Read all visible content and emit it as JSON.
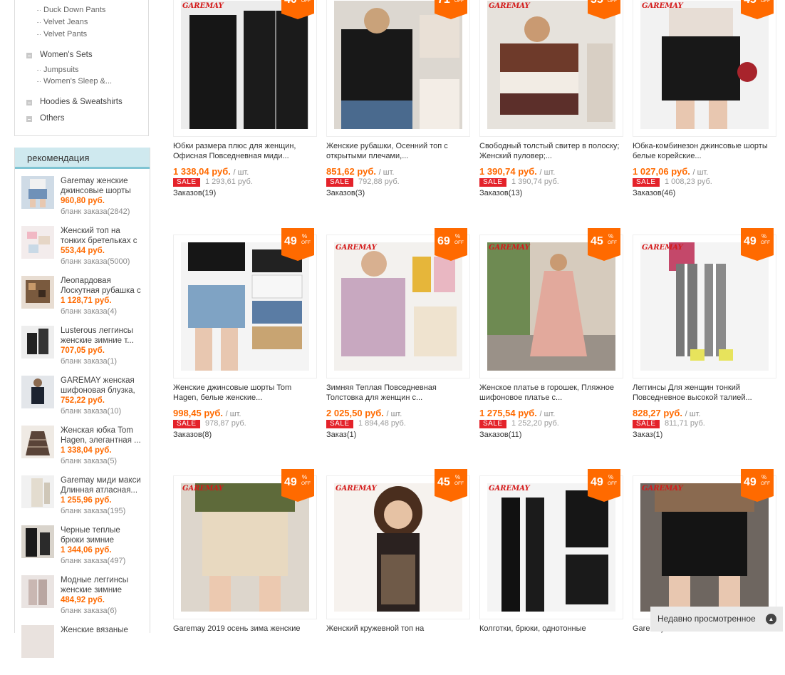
{
  "sidebar": {
    "categories_top": [
      "Duck Down Pants",
      "Velvet Jeans",
      "Velvet Pants"
    ],
    "womens_sets": "Women's Sets",
    "womens_sets_subs": [
      "Jumpsuits",
      "Women's Sleep &..."
    ],
    "hoodies": "Hoodies & Sweatshirts",
    "others": "Others"
  },
  "recommendation": {
    "heading": "рекомендация",
    "items": [
      {
        "title": "Garemay женские джинсовые шорты",
        "price": "960,80 руб.",
        "orders": "бланк заказа(2842)"
      },
      {
        "title": "Женский топ на тонких бретельках с",
        "price": "553,44 руб.",
        "orders": "бланк заказа(5000)"
      },
      {
        "title": "Леопардовая Лоскутная рубашка с",
        "price": "1 128,71 руб.",
        "orders": "бланк заказа(4)"
      },
      {
        "title": "Lusterous леггинсы женские зимние т...",
        "price": "707,05 руб.",
        "orders": "бланк заказа(1)"
      },
      {
        "title": "GAREMAY женская шифоновая блузка,",
        "price": "752,22 руб.",
        "orders": "бланк заказа(10)"
      },
      {
        "title": "Женская юбка Tom Hagen, элегантная ...",
        "price": "1 338,04 руб.",
        "orders": "бланк заказа(5)"
      },
      {
        "title": "Garemay миди макси Длинная атласная...",
        "price": "1 255,96 руб.",
        "orders": "бланк заказа(195)"
      },
      {
        "title": "Черные теплые брюки зимние",
        "price": "1 344,06 руб.",
        "orders": "бланк заказа(497)"
      },
      {
        "title": "Модные леггинсы женские зимние",
        "price": "484,92 руб.",
        "orders": "бланк заказа(6)"
      },
      {
        "title": "Женские вязаные",
        "price": "",
        "orders": ""
      }
    ]
  },
  "labels": {
    "unit": "/ шт.",
    "sale": "SALE",
    "percent": "%",
    "off": "OFF"
  },
  "products": [
    {
      "discount": "40",
      "brand": "GAREMAY",
      "title": "Юбки размера плюс для женщин, Офисная Повседневная миди...",
      "price": "1 338,04 руб.",
      "old": "1 293,61 руб.",
      "orders": "Заказов(19)"
    },
    {
      "discount": "71",
      "brand": "",
      "title": "Женские рубашки, Осенний топ с открытыми плечами,...",
      "price": "851,62 руб.",
      "old": "792,88 руб.",
      "orders": "Заказов(3)"
    },
    {
      "discount": "35",
      "brand": "GAREMAY",
      "title": "Свободный толстый свитер в полоску; Женский пуловер;...",
      "price": "1 390,74 руб.",
      "old": "1 390,74 руб.",
      "orders": "Заказов(13)"
    },
    {
      "discount": "45",
      "brand": "GAREMAY",
      "title": "Юбка-комбинезон джинсовые шорты белые корейские...",
      "price": "1 027,06 руб.",
      "old": "1 008,23 руб.",
      "orders": "Заказов(46)"
    },
    {
      "discount": "49",
      "brand": "",
      "title": "Женские джинсовые шорты Tom Hagen, белые женские...",
      "price": "998,45 руб.",
      "old": "978,87 руб.",
      "orders": "Заказов(8)"
    },
    {
      "discount": "69",
      "brand": "GAREMAY",
      "title": "Зимняя Теплая Повседневная Толстовка для женщин с...",
      "price": "2 025,50 руб.",
      "old": "1 894,48 руб.",
      "orders": "Заказ(1)"
    },
    {
      "discount": "45",
      "brand": "GAREMAY",
      "title": "Женское платье в горошек, Пляжное шифоновое платье с...",
      "price": "1 275,54 руб.",
      "old": "1 252,20 руб.",
      "orders": "Заказов(11)"
    },
    {
      "discount": "49",
      "brand": "GAREMAY",
      "title": "Леггинсы Для женщин тонкий Повседневное высокой талией...",
      "price": "828,27 руб.",
      "old": "811,71 руб.",
      "orders": "Заказ(1)"
    },
    {
      "discount": "49",
      "brand": "GAREMAY",
      "title": "Garemay 2019 осень зима женские",
      "price": "",
      "old": "",
      "orders": ""
    },
    {
      "discount": "45",
      "brand": "GAREMAY",
      "title": "Женский кружевной топ на",
      "price": "",
      "old": "",
      "orders": ""
    },
    {
      "discount": "49",
      "brand": "GAREMAY",
      "title": "Колготки, брюки, однотонные",
      "price": "",
      "old": "",
      "orders": ""
    },
    {
      "discount": "49",
      "brand": "GAREMAY",
      "title": "Garemay",
      "price": "",
      "old": "",
      "orders": ""
    }
  ],
  "recently_viewed": "Недавно просмотренное",
  "colors": {
    "accent": "#ff6a00",
    "sale": "#e4222a",
    "rec_header": "#cfe9ef"
  }
}
